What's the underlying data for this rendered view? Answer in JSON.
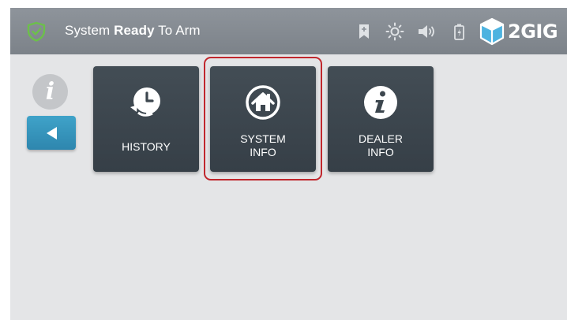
{
  "status": {
    "prefix": "System ",
    "emphasis": "Ready",
    "suffix": " To Arm",
    "shield_color": "#6cc04a",
    "icon": "shield-check-icon"
  },
  "topbar_icons": [
    "bookmark-icon",
    "brightness-icon",
    "volume-icon",
    "battery-icon"
  ],
  "brand": {
    "name": "2GIG",
    "icon": "2gig-cube-logo"
  },
  "side": {
    "info_glyph": "i",
    "back_icon": "back-arrow-icon"
  },
  "tiles": [
    {
      "label_lines": [
        "HISTORY"
      ],
      "icon": "history-clock-icon"
    },
    {
      "label_lines": [
        "SYSTEM",
        "INFO"
      ],
      "icon": "home-icon",
      "highlighted": true
    },
    {
      "label_lines": [
        "DEALER",
        "INFO"
      ],
      "icon": "info-icon"
    }
  ],
  "colors": {
    "topbar": "#868c93",
    "background": "#e4e5e7",
    "tile": "#3c464e",
    "accent_blue": "#3298c0",
    "highlight_red": "#c0272d"
  }
}
